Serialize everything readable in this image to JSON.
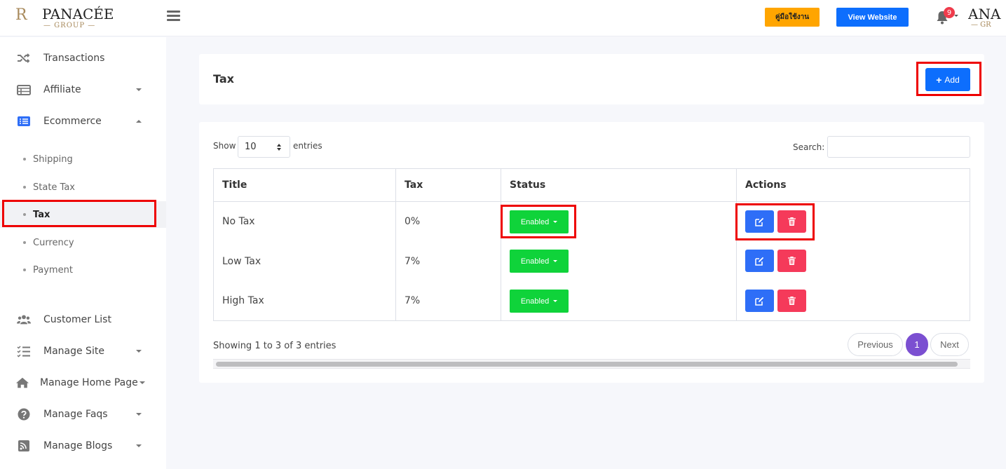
{
  "header": {
    "logo_mark": "R",
    "logo_word": "PANACÉE",
    "logo_sub": "— GROUP —",
    "guide_button": "คู่มือใช้งาน",
    "view_website_button": "View Website",
    "notification_count": "9",
    "brand_right_word": "ANA",
    "brand_right_sub": "— GR"
  },
  "sidebar": {
    "items": [
      {
        "label": "Transactions",
        "icon": "shuffle-icon"
      },
      {
        "label": "Affiliate",
        "icon": "table-icon"
      },
      {
        "label": "Ecommerce",
        "icon": "list-icon"
      },
      {
        "label": "Customer List",
        "icon": "users-icon"
      },
      {
        "label": "Manage Site",
        "icon": "checklist-icon"
      },
      {
        "label": "Manage Home Page",
        "icon": "home-icon"
      },
      {
        "label": "Manage Faqs",
        "icon": "question-icon"
      },
      {
        "label": "Manage Blogs",
        "icon": "rss-icon"
      }
    ],
    "ecommerce_sub": [
      "Shipping",
      "State Tax",
      "Tax",
      "Currency",
      "Payment"
    ],
    "active_sub": "Tax"
  },
  "page": {
    "title": "Tax",
    "add_button": "Add"
  },
  "table_controls": {
    "show_label": "Show",
    "entries_value": "10",
    "entries_label": "entries",
    "search_label": "Search:",
    "search_value": ""
  },
  "table": {
    "columns": [
      "Title",
      "Tax",
      "Status",
      "Actions"
    ],
    "rows": [
      {
        "title": "No Tax",
        "tax": "0%",
        "status": "Enabled"
      },
      {
        "title": "Low Tax",
        "tax": "7%",
        "status": "Enabled"
      },
      {
        "title": "High Tax",
        "tax": "7%",
        "status": "Enabled"
      }
    ]
  },
  "footer": {
    "info": "Showing 1 to 3 of 3 entries",
    "previous": "Previous",
    "current_page": "1",
    "next": "Next"
  },
  "colors": {
    "primary": "#0d6efd",
    "guide": "#ffa500",
    "enabled": "#0fd33a",
    "edit": "#2e6ef7",
    "delete": "#f53a5a",
    "page_active": "#7b4fd1",
    "highlight": "#ee0000"
  }
}
